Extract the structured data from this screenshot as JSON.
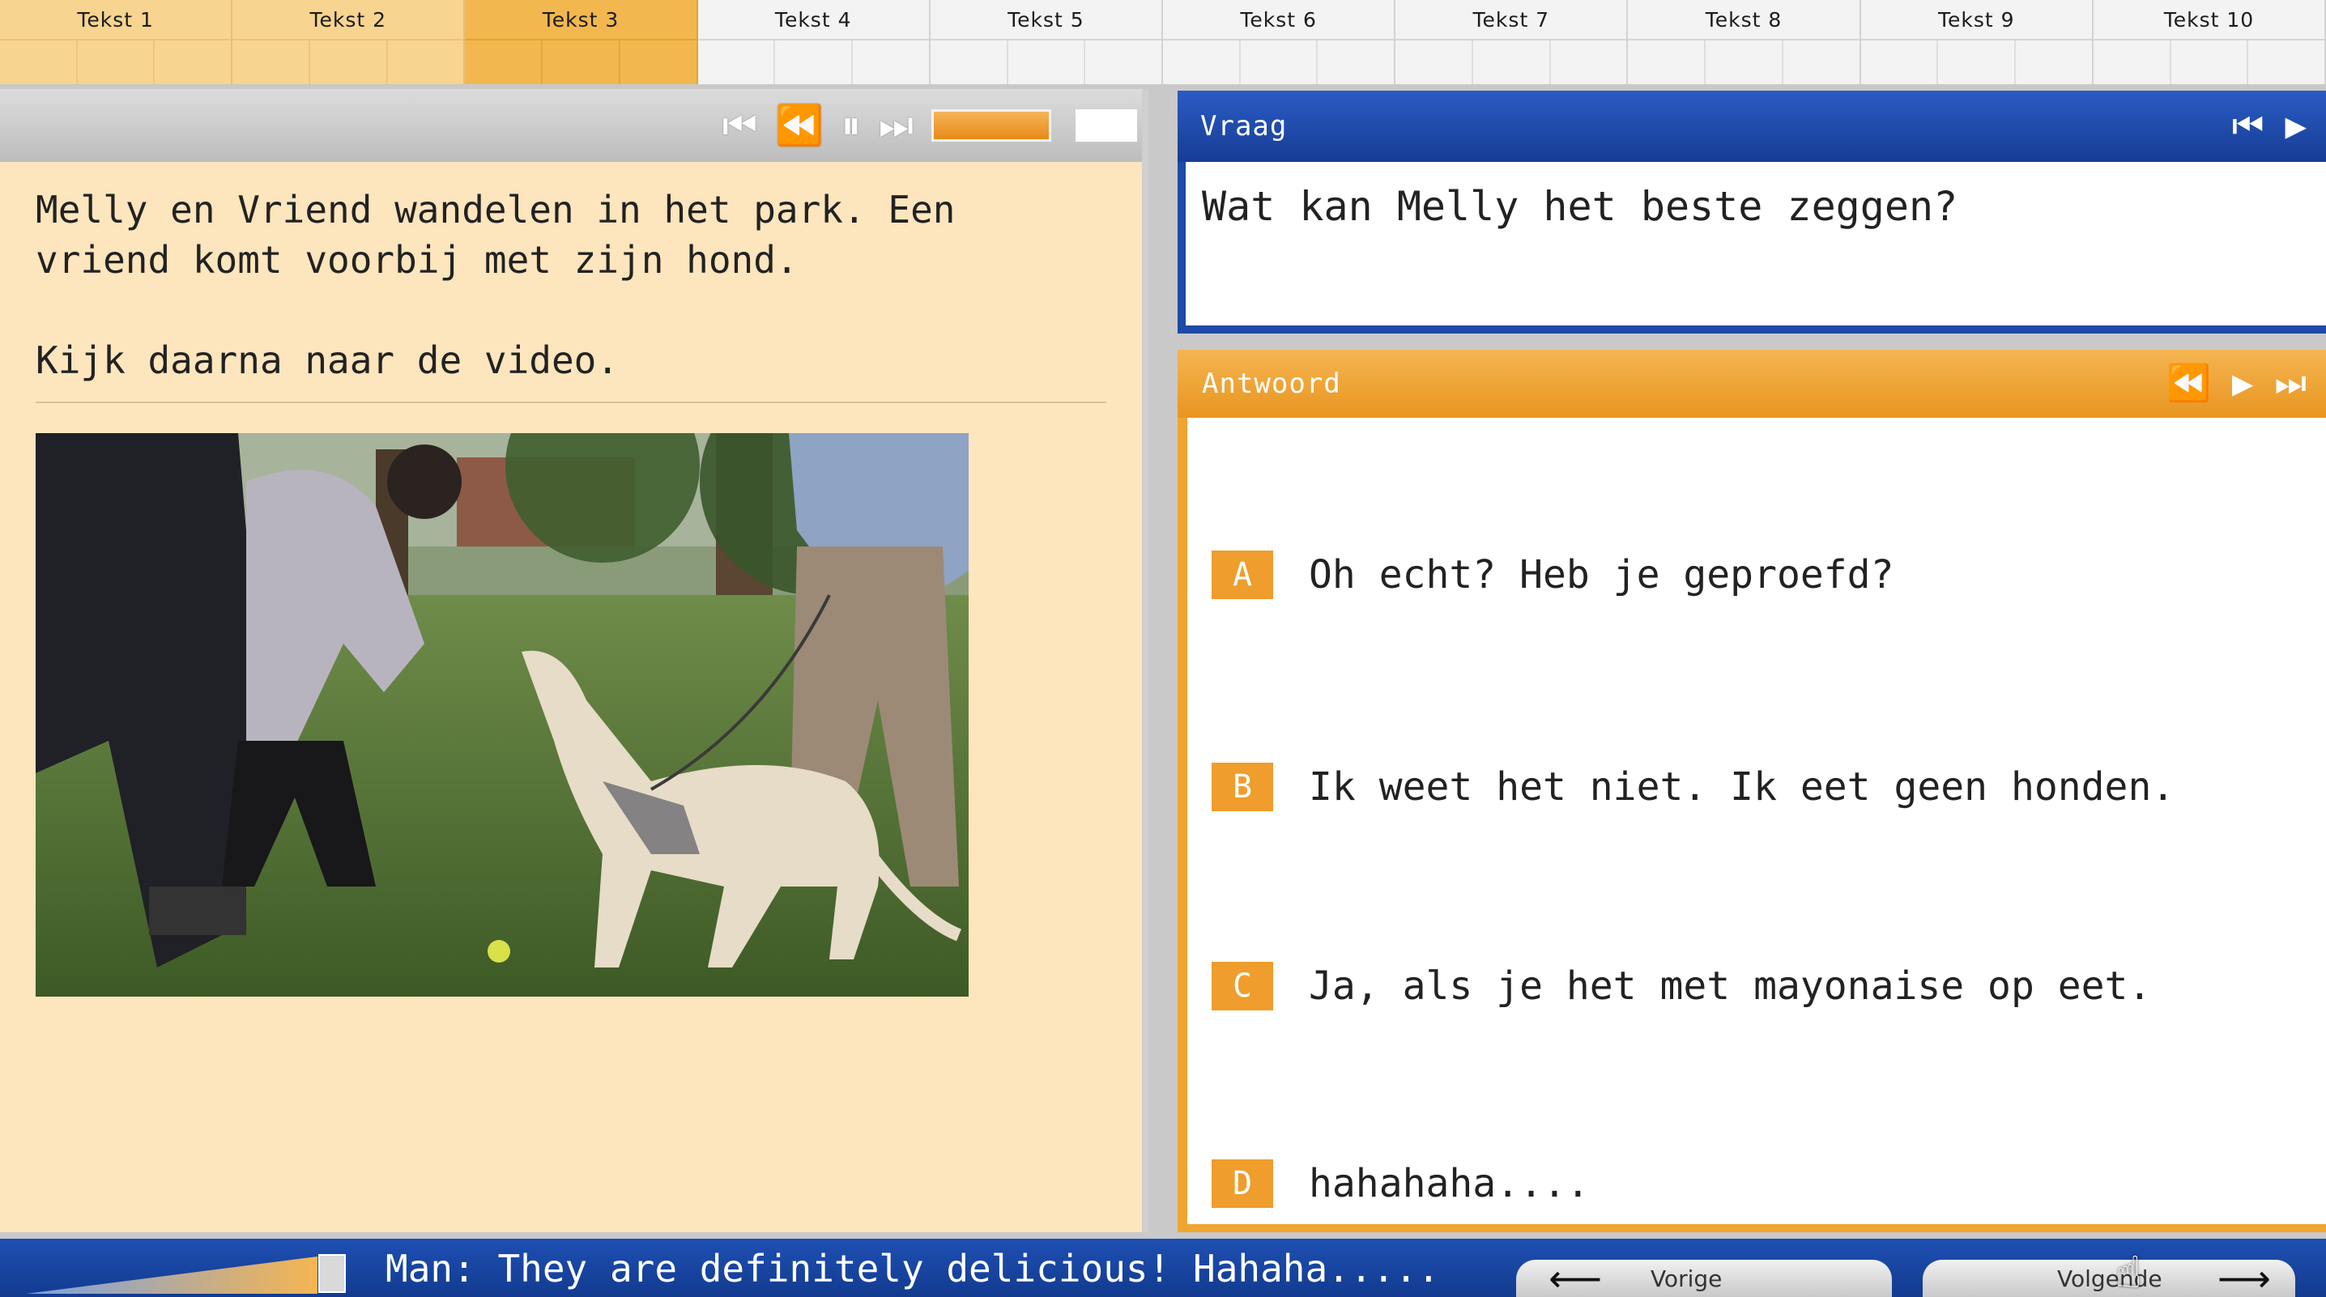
{
  "tabs": [
    {
      "label": "Tekst 1",
      "state": "done"
    },
    {
      "label": "Tekst 2",
      "state": "done"
    },
    {
      "label": "Tekst 3",
      "state": "current"
    },
    {
      "label": "Tekst 4",
      "state": "todo"
    },
    {
      "label": "Tekst 5",
      "state": "todo"
    },
    {
      "label": "Tekst 6",
      "state": "todo"
    },
    {
      "label": "Tekst 7",
      "state": "todo"
    },
    {
      "label": "Tekst 8",
      "state": "todo"
    },
    {
      "label": "Tekst 9",
      "state": "todo"
    },
    {
      "label": "Tekst 10",
      "state": "todo"
    }
  ],
  "left_panel": {
    "toolbar_icons": [
      "skip-back-icon",
      "rewind-icon",
      "pause-icon",
      "fast-forward-icon"
    ],
    "paragraphs": [
      "Melly en Vriend wandelen in het park. Een vriend komt voorbij met zijn hond.",
      "Kijk daarna naar de video."
    ]
  },
  "question": {
    "title": "Vraag",
    "text": "Wat kan Melly het beste zeggen?"
  },
  "answer": {
    "title": "Antwoord",
    "options": [
      {
        "letter": "A",
        "text": "Oh echt? Heb je geproefd?"
      },
      {
        "letter": "B",
        "text": "Ik weet het niet. Ik eet geen honden."
      },
      {
        "letter": "C",
        "text": "Ja, als je het met mayonaise op eet."
      },
      {
        "letter": "D",
        "text": "hahahaha...."
      }
    ]
  },
  "bottom": {
    "subtitle": "Man: They are definitely delicious! Hahaha.....",
    "prev_label": "Vorige",
    "next_label": "Volgende"
  },
  "colors": {
    "accent_orange": "#f0a530",
    "accent_blue": "#1e4aa8",
    "text_bg": "#fde5bd"
  }
}
